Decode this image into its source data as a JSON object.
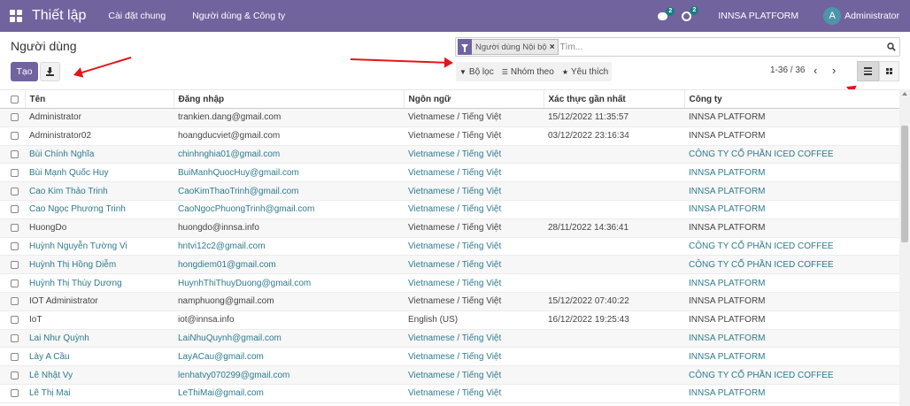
{
  "navbar": {
    "brand": "Thiết lập",
    "menu": [
      "Cài đặt chung",
      "Người dùng & Công ty"
    ],
    "chat_count": "2",
    "activity_count": "2",
    "company": "INNSA PLATFORM",
    "avatar_letter": "A",
    "username": "Administrator",
    "color": "#71639e"
  },
  "control_panel": {
    "title": "Người dùng",
    "create_label": "Tạo",
    "search": {
      "facet_label": "Người dùng Nội bộ",
      "facet_remove": "×",
      "placeholder": "Tìm..."
    },
    "filters": {
      "filter_label": "Bộ lọc",
      "groupby_label": "Nhóm theo",
      "favorites_label": "Yêu thích"
    },
    "pager": "1-36 / 36",
    "pager_prev": "‹",
    "pager_next": "›"
  },
  "table": {
    "columns": [
      "Tên",
      "Đăng nhập",
      "Ngôn ngữ",
      "Xác thực gần nhất",
      "Công ty"
    ],
    "rows": [
      {
        "name": "Administrator",
        "login": "trankien.dang@gmail.com",
        "lang": "Vietnamese / Tiếng Việt",
        "auth": "15/12/2022 11:35:57",
        "company": "INNSA PLATFORM",
        "link": false
      },
      {
        "name": "Administrator02",
        "login": "hoangducviet@gmail.com",
        "lang": "Vietnamese / Tiếng Việt",
        "auth": "03/12/2022 23:16:34",
        "company": "INNSA PLATFORM",
        "link": false
      },
      {
        "name": "Bùi Chính Nghĩa",
        "login": "chinhnghia01@gmail.com",
        "lang": "Vietnamese / Tiếng Việt",
        "auth": "",
        "company": "CÔNG TY CỔ PHẦN ICED COFFEE",
        "link": true
      },
      {
        "name": "Bùi Mạnh Quốc Huy",
        "login": "BuiManhQuocHuy@gmail.com",
        "lang": "Vietnamese / Tiếng Việt",
        "auth": "",
        "company": "INNSA PLATFORM",
        "link": true
      },
      {
        "name": "Cao Kim Thảo Trinh",
        "login": "CaoKimThaoTrinh@gmail.com",
        "lang": "Vietnamese / Tiếng Việt",
        "auth": "",
        "company": "INNSA PLATFORM",
        "link": true
      },
      {
        "name": "Cao Ngọc Phương Trinh",
        "login": "CaoNgocPhuongTrinh@gmail.com",
        "lang": "Vietnamese / Tiếng Việt",
        "auth": "",
        "company": "INNSA PLATFORM",
        "link": true
      },
      {
        "name": "HuongDo",
        "login": "huongdo@innsa.info",
        "lang": "Vietnamese / Tiếng Việt",
        "auth": "28/11/2022 14:36:41",
        "company": "INNSA PLATFORM",
        "link": false
      },
      {
        "name": "Huỳnh Nguyễn Tường Vi",
        "login": "hntvi12c2@gmail.com",
        "lang": "Vietnamese / Tiếng Việt",
        "auth": "",
        "company": "CÔNG TY CỔ PHẦN ICED COFFEE",
        "link": true
      },
      {
        "name": "Huỳnh Thị Hồng Diễm",
        "login": "hongdiem01@gmail.com",
        "lang": "Vietnamese / Tiếng Việt",
        "auth": "",
        "company": "CÔNG TY CỔ PHẦN ICED COFFEE",
        "link": true
      },
      {
        "name": "Huỳnh Thị Thùy Dương",
        "login": "HuynhThiThuyDuong@gmail.com",
        "lang": "Vietnamese / Tiếng Việt",
        "auth": "",
        "company": "INNSA PLATFORM",
        "link": true
      },
      {
        "name": "IOT Administrator",
        "login": "namphuong@gmail.com",
        "lang": "Vietnamese / Tiếng Việt",
        "auth": "15/12/2022 07:40:22",
        "company": "INNSA PLATFORM",
        "link": false
      },
      {
        "name": "IoT",
        "login": "iot@innsa.info",
        "lang": "English (US)",
        "auth": "16/12/2022 19:25:43",
        "company": "INNSA PLATFORM",
        "link": false
      },
      {
        "name": "Lai Như Quỳnh",
        "login": "LaiNhuQuynh@gmail.com",
        "lang": "Vietnamese / Tiếng Việt",
        "auth": "",
        "company": "INNSA PLATFORM",
        "link": true
      },
      {
        "name": "Lày A Cầu",
        "login": "LayACau@gmail.com",
        "lang": "Vietnamese / Tiếng Việt",
        "auth": "",
        "company": "INNSA PLATFORM",
        "link": true
      },
      {
        "name": "Lê Nhật Vy",
        "login": "lenhatvy070299@gmail.com",
        "lang": "Vietnamese / Tiếng Việt",
        "auth": "",
        "company": "CÔNG TY CỔ PHẦN ICED COFFEE",
        "link": true
      },
      {
        "name": "Lê Thị Mai",
        "login": "LeThiMai@gmail.com",
        "lang": "Vietnamese / Tiếng Việt",
        "auth": "",
        "company": "INNSA PLATFORM",
        "link": true
      }
    ]
  },
  "icons": {
    "apps": "apps-grid-icon",
    "search": "search-icon",
    "list_view": "list-view-icon",
    "kanban_view": "kanban-view-icon"
  },
  "colors": {
    "link": "#2f7b8f",
    "annotation_arrow": "#e4161a"
  }
}
